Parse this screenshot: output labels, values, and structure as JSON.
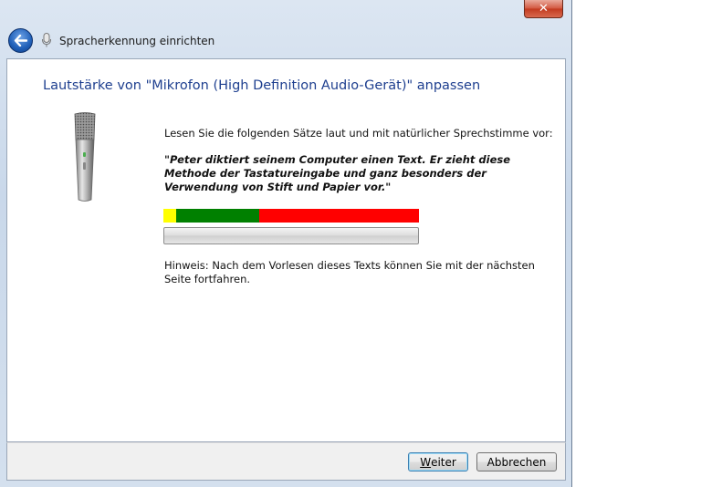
{
  "window": {
    "title": "Spracherkennung einrichten",
    "close_label": "✕"
  },
  "page": {
    "title": "Lautstärke von \"Mikrofon (High Definition Audio-Gerät)\" anpassen",
    "instruction": "Lesen Sie die folgenden Sätze laut und mit natürlicher Sprechstimme vor:",
    "sample_text": "\"Peter diktiert seinem Computer einen Text. Er zieht diese Methode der Tastatureingabe und ganz besonders der Verwendung von Stift und Papier vor.\"",
    "hint": "Hinweis: Nach dem Vorlesen dieses Texts können Sie mit der nächsten Seite fortfahren."
  },
  "level_meter": {
    "colors": {
      "low": "#ffff00",
      "good": "#008000",
      "high": "#ff0000"
    }
  },
  "progress": {
    "value": 0
  },
  "buttons": {
    "next_mnemonic": "W",
    "next_rest": "eiter",
    "cancel": "Abbrechen"
  },
  "icons": {
    "back": "back-arrow-icon",
    "small_mic": "microphone-icon",
    "large_mic": "microphone-icon"
  }
}
